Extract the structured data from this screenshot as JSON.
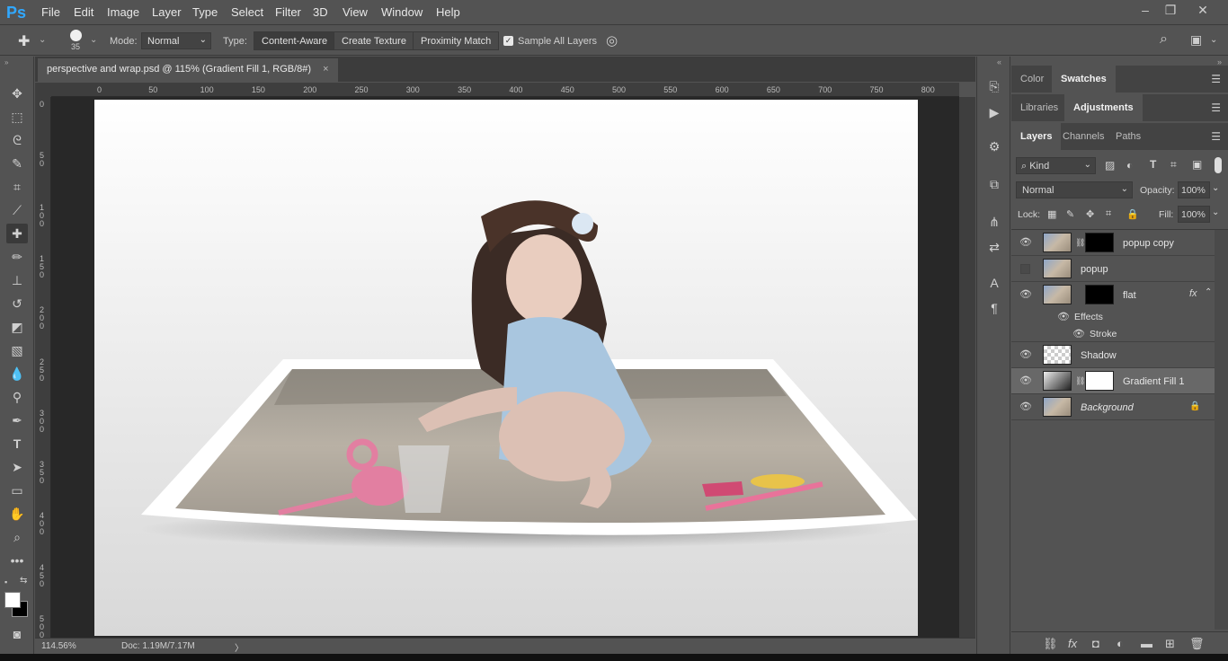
{
  "app": {
    "logo": "Ps"
  },
  "menubar": {
    "items": [
      "File",
      "Edit",
      "Image",
      "Layer",
      "Type",
      "Select",
      "Filter",
      "3D",
      "View",
      "Window",
      "Help"
    ],
    "window_controls": [
      "–",
      "❐",
      "✕"
    ]
  },
  "options": {
    "brush_size": "35",
    "mode_label": "Mode:",
    "mode_value": "Normal",
    "type_label": "Type:",
    "type_buttons": [
      "Content-Aware",
      "Create Texture",
      "Proximity Match"
    ],
    "sample_all_layers": "Sample All Layers"
  },
  "document": {
    "tab_title": "perspective and wrap.psd @ 115% (Gradient Fill 1, RGB/8#)",
    "close": "×"
  },
  "ruler_h": [
    "0",
    "50",
    "100",
    "150",
    "200",
    "250",
    "300",
    "350",
    "400",
    "450",
    "500",
    "550",
    "600",
    "650",
    "700",
    "750",
    "800"
  ],
  "ruler_v": [
    "0",
    "5 0",
    "1 0 0",
    "1 5 0",
    "2 0 0",
    "2 5 0",
    "3 0 0",
    "3 5 0",
    "4 0 0",
    "4 5 0",
    "5 0 0"
  ],
  "status": {
    "zoom": "114.56%",
    "doc": "Doc: 1.19M/7.17M",
    "arrow": "〉"
  },
  "panels": {
    "color_tabs": [
      "Color",
      "Swatches"
    ],
    "adj_tabs": [
      "Libraries",
      "Adjustments"
    ],
    "layer_tabs": [
      "Layers",
      "Channels",
      "Paths"
    ],
    "filter_kind": "Kind",
    "blend_mode": "Normal",
    "opacity_label": "Opacity:",
    "opacity_value": "100%",
    "lock_label": "Lock:",
    "fill_label": "Fill:",
    "fill_value": "100%",
    "layers": [
      {
        "name": "popup copy",
        "visible": true
      },
      {
        "name": "popup",
        "visible": false
      },
      {
        "name": "flat",
        "visible": true,
        "fx": "fx"
      },
      {
        "name": "Shadow",
        "visible": true
      },
      {
        "name": "Gradient Fill 1",
        "visible": true,
        "selected": true
      },
      {
        "name": "Background",
        "visible": true,
        "locked": true
      }
    ],
    "effects_label": "Effects",
    "stroke_label": "Stroke"
  },
  "colors": {
    "accent": "#31a8ff",
    "ui_bg": "#535353",
    "canvas_bg": "#282828"
  }
}
